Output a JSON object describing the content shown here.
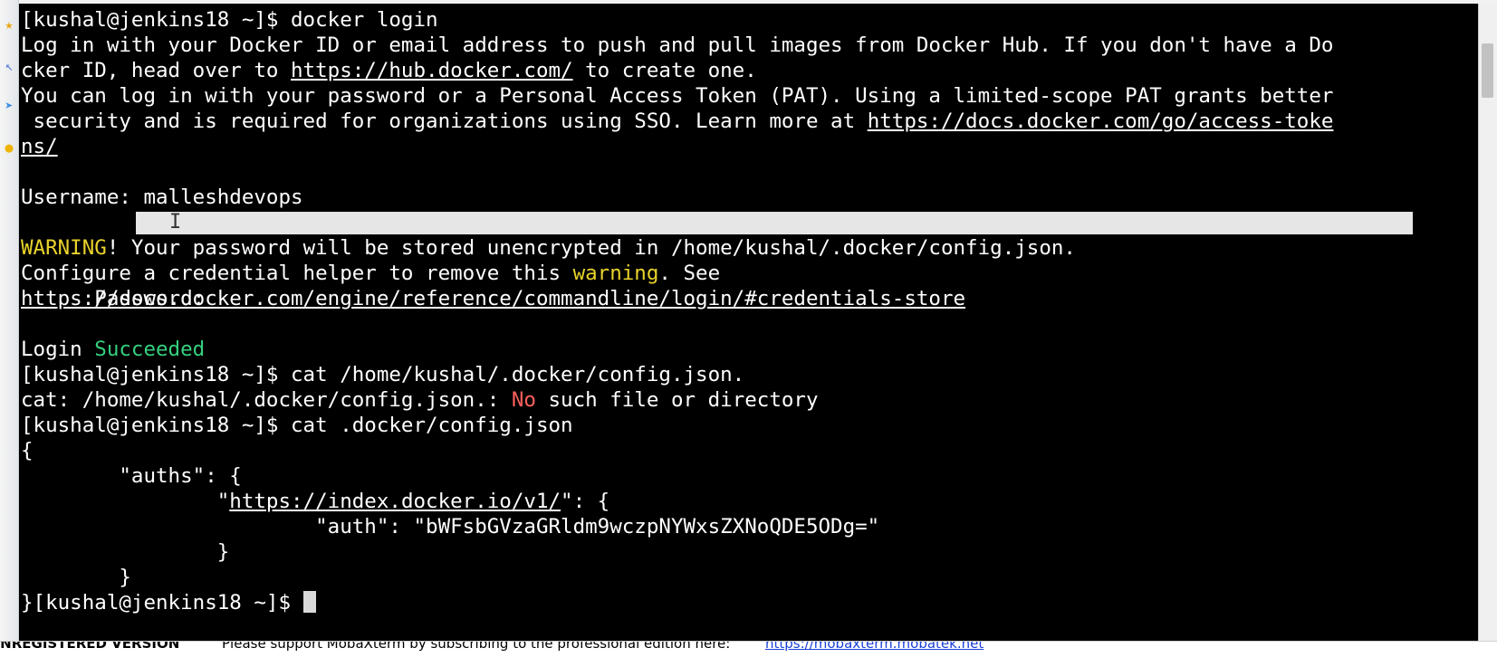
{
  "toolbar": {
    "icons": [
      "star-icon",
      "arrow-icon",
      "send-icon",
      "bulb-icon"
    ]
  },
  "terminal": {
    "line01": "[kushal@jenkins18 ~]$ docker login",
    "line02": "Log in with your Docker ID or email address to push and pull images from Docker Hub. If you don't have a Do",
    "line03_a": "cker ID, head over to ",
    "line03_url": "https://hub.docker.com/",
    "line03_b": " to create one.",
    "line04": "You can log in with your password or a Personal Access Token (PAT). Using a limited-scope PAT grants better",
    "line05_a": " security and is required for organizations using SSO. Learn more at ",
    "line05_url": "https://docs.docker.com/go/access-toke",
    "line06_url": "ns/",
    "line08": "Username: malleshdevops",
    "line09": "Password:",
    "line10_warn": "WARNING",
    "line10_b": "! Your password will be stored unencrypted in /home/kushal/.docker/config.json.",
    "line11_a": "Configure a credential helper to remove this ",
    "line11_warn": "warning",
    "line11_b": ". See",
    "line12_url": "https://docs.docker.com/engine/reference/commandline/login/#credentials-store",
    "line14_a": "Login ",
    "line14_ok": "Succeeded",
    "line15": "[kushal@jenkins18 ~]$ cat /home/kushal/.docker/config.json.",
    "line16_a": "cat: /home/kushal/.docker/config.json.: ",
    "line16_err": "No",
    "line16_b": " such file or directory",
    "line17": "[kushal@jenkins18 ~]$ cat .docker/config.json",
    "line18": "{",
    "line19": "        \"auths\": {",
    "line20_a": "                \"",
    "line20_url": "https://index.docker.io/v1/",
    "line20_b": "\": {",
    "line21": "                        \"auth\": \"bWFsbGVzaGRldm9wczpNYWxsZXNoQDE5ODg=\"",
    "line22": "                }",
    "line23": "        }",
    "line24": "}[kushal@jenkins18 ~]$ "
  },
  "statusbar": {
    "version": "UNREGISTERED VERSION",
    "message": "Please support MobaXterm by subscribing to the professional edition here:",
    "link": "https://mobaxterm.mobatek.net"
  }
}
